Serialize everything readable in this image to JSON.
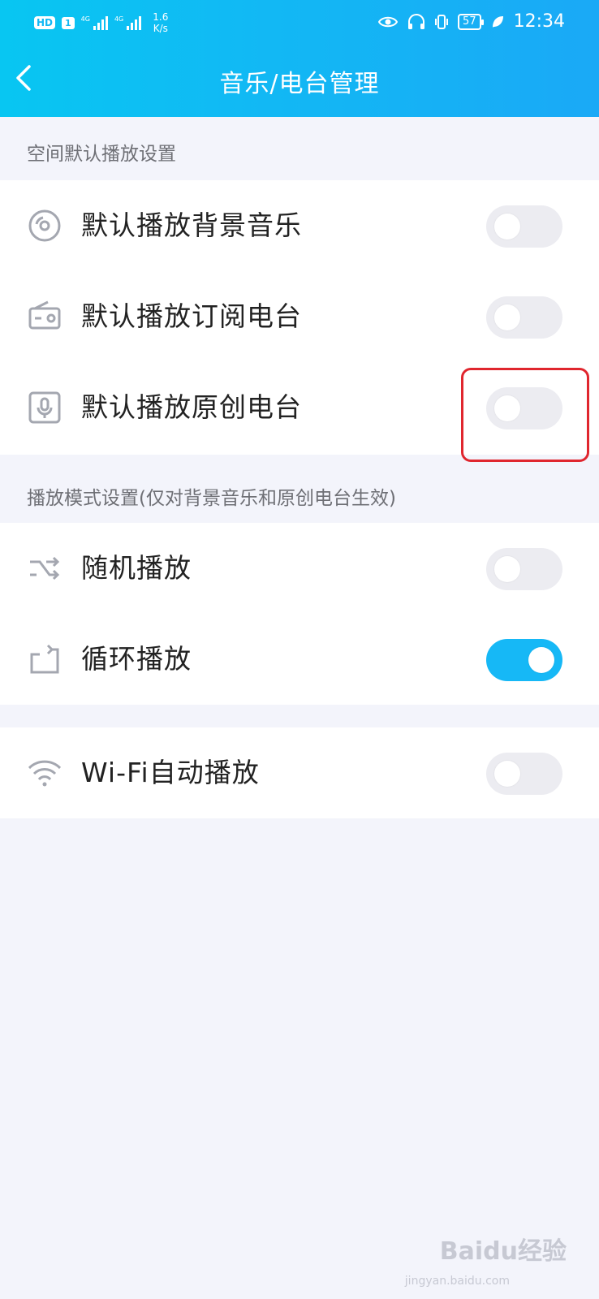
{
  "status_bar": {
    "hd": "HD",
    "sim": "1",
    "net1": "4G",
    "net2": "4G",
    "speed_value": "1.6",
    "speed_unit": "K/s",
    "battery": "57",
    "time": "12:34"
  },
  "header": {
    "title": "音乐/电台管理"
  },
  "sections": {
    "default": {
      "header": "空间默认播放设置",
      "items": [
        {
          "label": "默认播放背景音乐",
          "icon": "disc-icon",
          "enabled": false
        },
        {
          "label": "默认播放订阅电台",
          "icon": "radio-icon",
          "enabled": false
        },
        {
          "label": "默认播放原创电台",
          "icon": "microphone-icon",
          "enabled": false
        }
      ]
    },
    "mode": {
      "header": "播放模式设置(仅对背景音乐和原创电台生效)",
      "items": [
        {
          "label": "随机播放",
          "icon": "shuffle-icon",
          "enabled": false
        },
        {
          "label": "循环播放",
          "icon": "repeat-icon",
          "enabled": true
        }
      ]
    },
    "wifi": {
      "items": [
        {
          "label": "Wi-Fi自动播放",
          "icon": "wifi-icon",
          "enabled": false
        }
      ]
    }
  },
  "colors": {
    "header_gradient_start": "#08c6f2",
    "header_gradient_end": "#1aa9f6",
    "toggle_on": "#16b8f6",
    "toggle_off": "#ececf1",
    "highlight_box": "#e0262e",
    "background": "#f3f4fb"
  },
  "watermark": {
    "text": "Baidu经验",
    "sub": "jingyan.baidu.com"
  }
}
